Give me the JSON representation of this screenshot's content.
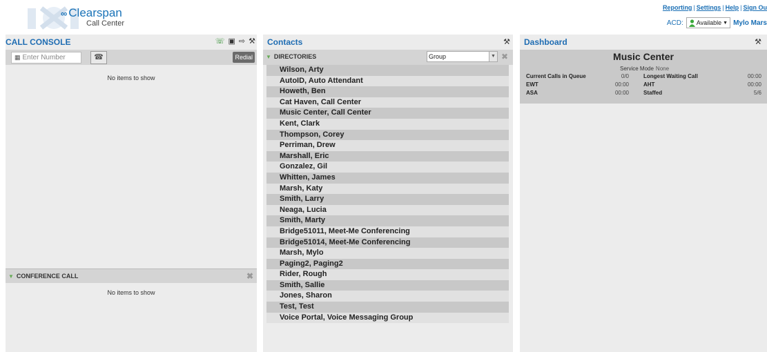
{
  "header": {
    "brand": "Clearspan",
    "brand_mark": "∞",
    "product": "Call Center",
    "links": [
      "Reporting",
      "Settings",
      "Help",
      "Sign Ou"
    ],
    "acd_label": "ACD:",
    "acd_status": "Available",
    "user_name": "Mylo Mars"
  },
  "call_console": {
    "title": "CALL CONSOLE",
    "enter_number_placeholder": "Enter Number",
    "redial_label": "Redial",
    "no_items": "No items to show",
    "conference_title": "CONFERENCE CALL",
    "conference_no_items": "No items to show"
  },
  "contacts": {
    "title": "Contacts",
    "directories_label": "DIRECTORIES",
    "group_select_value": "Group",
    "items": [
      "Wilson, Arty",
      "AutoID, Auto Attendant",
      "Howeth, Ben",
      "Cat Haven, Call Center",
      "Music Center, Call Center",
      "Kent, Clark",
      "Thompson, Corey",
      "Perriman, Drew",
      "Marshall, Eric",
      "Gonzalez, Gil",
      "Whitten, James",
      "Marsh, Katy",
      "Smith, Larry",
      "Neaga, Lucia",
      "Smith, Marty",
      "Bridge51011, Meet-Me Conferencing",
      "Bridge51014, Meet-Me Conferencing",
      "Marsh, Mylo",
      "Paging2, Paging2",
      "Rider, Rough",
      "Smith, Sallie",
      "Jones, Sharon",
      "Test, Test",
      "Voice Portal, Voice Messaging Group"
    ]
  },
  "dashboard": {
    "title": "Dashboard",
    "queue_name": "Music Center",
    "service_mode_label": "Service Mode",
    "service_mode_value": "None",
    "stats": {
      "current_calls_label": "Current Calls in Queue",
      "current_calls_value": "0/0",
      "longest_waiting_label": "Longest Waiting Call",
      "longest_waiting_value": "00:00",
      "ewt_label": "EWT",
      "ewt_value": "00:00",
      "aht_label": "AHT",
      "aht_value": "00:00",
      "asa_label": "ASA",
      "asa_value": "00:00",
      "staffed_label": "Staffed",
      "staffed_value": "5/6"
    }
  },
  "colors": {
    "accent": "#1f6db3",
    "panel_bg": "#ececec",
    "row_odd": "#c8c8c8",
    "row_even": "#e1e1e1",
    "dashboard_card": "#c9c9c9"
  },
  "icons": [
    "logo-watermark-icon",
    "clearspan-mark-icon",
    "answer-icon",
    "console-icon",
    "transfer-icon",
    "tools-icon",
    "phone-icon",
    "user-available-icon",
    "close-icon"
  ]
}
